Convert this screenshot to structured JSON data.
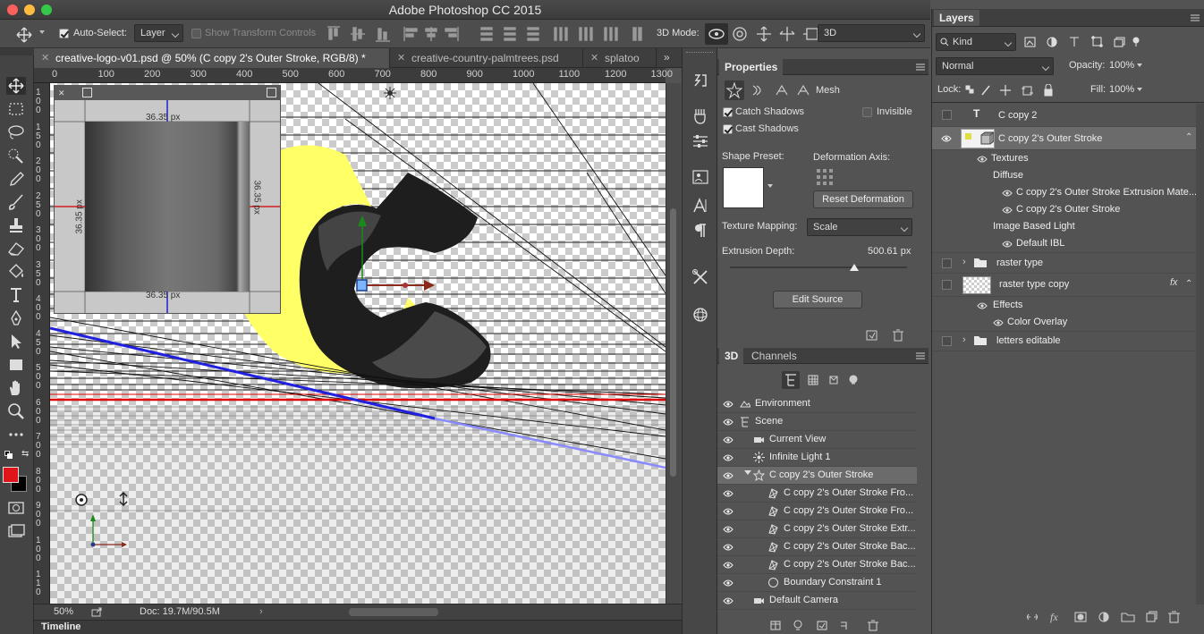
{
  "app": {
    "title": "Adobe Photoshop CC 2015"
  },
  "options_bar": {
    "auto_select_label": "Auto-Select:",
    "auto_select_value": "Layer",
    "show_transform_label": "Show Transform Controls",
    "mode_3d_label": "3D Mode:",
    "mode_3d_value": "3D"
  },
  "doc_tabs": [
    {
      "label": "creative-logo-v01.psd @ 50% (C copy 2's Outer Stroke, RGB/8) *",
      "active": true
    },
    {
      "label": "creative-country-palmtrees.psd",
      "active": false
    },
    {
      "label": "splatoo",
      "active": false
    }
  ],
  "ruler_top": [
    "0",
    "100",
    "200",
    "300",
    "400",
    "500",
    "600",
    "700",
    "800",
    "900",
    "1000",
    "1100",
    "1200",
    "1300"
  ],
  "ruler_left": [
    [
      "1",
      "0",
      "0"
    ],
    [
      "1",
      "5",
      "0"
    ],
    [
      "2",
      "0",
      "0"
    ],
    [
      "2",
      "5",
      "0"
    ],
    [
      "3",
      "0",
      "0"
    ],
    [
      "3",
      "5",
      "0"
    ],
    [
      "4",
      "0",
      "0"
    ],
    [
      "4",
      "5",
      "0"
    ],
    [
      "5",
      "0",
      "0"
    ],
    [
      "6",
      "0",
      "0"
    ],
    [
      "7",
      "0",
      "0"
    ],
    [
      "8",
      "0",
      "0"
    ],
    [
      "9",
      "0",
      "0"
    ],
    [
      "1",
      "0",
      "0"
    ],
    [
      "1",
      "1",
      "0"
    ]
  ],
  "texture_window": {
    "dim_top": "36.35 px",
    "dim_bottom": "36.35 px",
    "dim_left": "36.35 px",
    "dim_right": "36.35 px"
  },
  "status_bar": {
    "zoom": "50%",
    "doc": "Doc: 19.7M/90.5M"
  },
  "timeline": {
    "label": "Timeline"
  },
  "properties": {
    "title": "Properties",
    "mesh_label": "Mesh",
    "catch_shadows": "Catch Shadows",
    "cast_shadows": "Cast Shadows",
    "invisible": "Invisible",
    "shape_preset": "Shape Preset:",
    "deformation_axis": "Deformation Axis:",
    "reset_deformation": "Reset Deformation",
    "texture_mapping_label": "Texture Mapping:",
    "texture_mapping_value": "Scale",
    "extrusion_depth_label": "Extrusion Depth:",
    "extrusion_depth_value": "500.61 px",
    "extrusion_depth_fraction": 0.7,
    "edit_source": "Edit Source"
  },
  "panel_3d": {
    "tab_3d": "3D",
    "tab_channels": "Channels",
    "items": [
      {
        "label": "Environment",
        "indent": 0,
        "icon": "environment-icon",
        "selected": false
      },
      {
        "label": "Scene",
        "indent": 0,
        "icon": "scene-icon",
        "selected": false
      },
      {
        "label": "Current View",
        "indent": 1,
        "icon": "camera-icon",
        "selected": false
      },
      {
        "label": "Infinite Light 1",
        "indent": 1,
        "icon": "light-icon",
        "selected": false
      },
      {
        "label": "C copy 2's Outer Stroke",
        "indent": 1,
        "icon": "mesh-icon",
        "selected": true
      },
      {
        "label": "C copy 2's Outer Stroke Fro...",
        "indent": 2,
        "icon": "material-icon",
        "selected": false
      },
      {
        "label": "C copy 2's Outer Stroke Fro...",
        "indent": 2,
        "icon": "material-icon",
        "selected": false
      },
      {
        "label": "C copy 2's Outer Stroke Extr...",
        "indent": 2,
        "icon": "material-icon",
        "selected": false
      },
      {
        "label": "C copy 2's Outer Stroke Bac...",
        "indent": 2,
        "icon": "material-icon",
        "selected": false
      },
      {
        "label": "C copy 2's Outer Stroke Bac...",
        "indent": 2,
        "icon": "material-icon",
        "selected": false
      },
      {
        "label": "Boundary Constraint 1",
        "indent": 2,
        "icon": "constraint-icon",
        "selected": false
      },
      {
        "label": "Default Camera",
        "indent": 1,
        "icon": "camera-icon",
        "selected": false
      }
    ]
  },
  "layers": {
    "title": "Layers",
    "filter_kind": "Kind",
    "blend_mode": "Normal",
    "opacity_label": "Opacity:",
    "opacity_value": "100%",
    "lock_label": "Lock:",
    "fill_label": "Fill:",
    "fill_value": "100%",
    "rows": [
      {
        "label": "C copy 2",
        "kind": "text"
      },
      {
        "label": "C copy 2's Outer Stroke",
        "kind": "3d"
      },
      {
        "label": "Textures",
        "kind": "sub"
      },
      {
        "label": "Diffuse",
        "kind": "sub2"
      },
      {
        "label": "C copy 2's Outer Stroke Extrusion Mate...",
        "kind": "sub3"
      },
      {
        "label": "C copy 2's Outer Stroke",
        "kind": "sub3"
      },
      {
        "label": "Image Based Light",
        "kind": "sub2"
      },
      {
        "label": "Default IBL",
        "kind": "sub3"
      },
      {
        "label": "raster type",
        "kind": "group"
      },
      {
        "label": "raster type copy",
        "kind": "raster"
      },
      {
        "label": "Effects",
        "kind": "sub"
      },
      {
        "label": "Color Overlay",
        "kind": "sub2"
      },
      {
        "label": "letters editable",
        "kind": "group"
      }
    ]
  },
  "colors": {
    "foreground": "#e0141b",
    "background": "#000000",
    "shape_yellow": "#ffff66"
  }
}
